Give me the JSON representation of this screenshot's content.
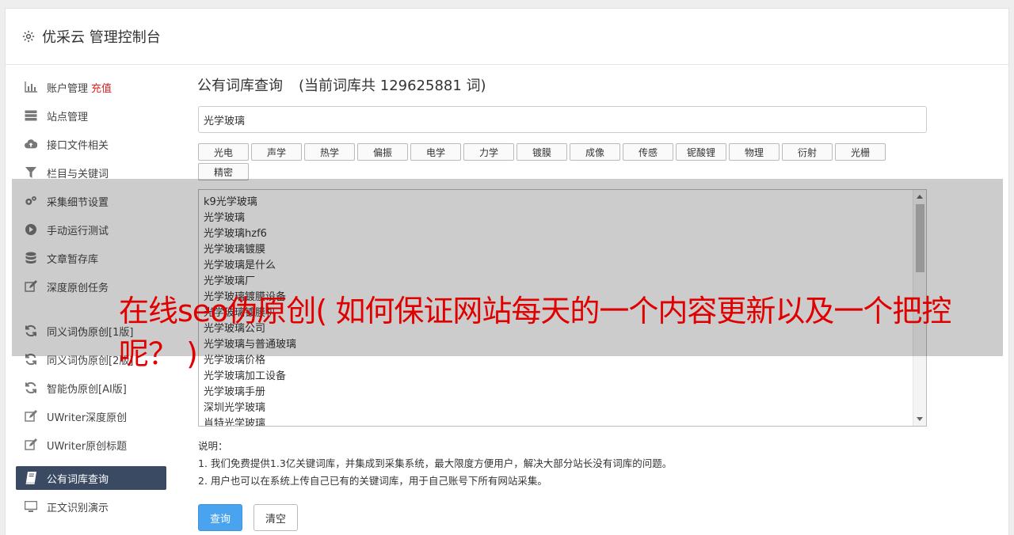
{
  "header": {
    "title": "优采云 管理控制台"
  },
  "sidebar": {
    "items": [
      {
        "label": "账户管理",
        "badge": "充值",
        "icon": "bar-chart-icon"
      },
      {
        "label": "站点管理",
        "icon": "server-icon"
      },
      {
        "label": "接口文件相关",
        "icon": "cloud-upload-icon"
      },
      {
        "label": "栏目与关键词",
        "icon": "filter-icon"
      },
      {
        "label": "采集细节设置",
        "icon": "gears-icon"
      },
      {
        "label": "手动运行测试",
        "icon": "play-circle-icon"
      },
      {
        "label": "文章暂存库",
        "icon": "database-icon"
      },
      {
        "label": "深度原创任务",
        "icon": "edit-icon"
      },
      {
        "label": "同义词伪原创[1版]",
        "icon": "refresh-icon"
      },
      {
        "label": "同义词伪原创[2版]",
        "icon": "refresh-icon"
      },
      {
        "label": "智能伪原创[AI版]",
        "icon": "refresh-icon"
      },
      {
        "label": "UWriter深度原创",
        "icon": "edit-icon"
      },
      {
        "label": "UWriter原创标题",
        "icon": "edit-icon"
      },
      {
        "label": "公有词库查询",
        "icon": "book-icon"
      },
      {
        "label": "正文识别演示",
        "icon": "monitor-icon"
      }
    ]
  },
  "main": {
    "title": "公有词库查询",
    "count_text": "(当前词库共 129625881 词)",
    "search_value": "光学玻璃",
    "tags": [
      "光电",
      "声学",
      "热学",
      "偏振",
      "电学",
      "力学",
      "镀膜",
      "成像",
      "传感",
      "铌酸锂",
      "物理",
      "衍射",
      "光栅",
      "精密"
    ],
    "results": [
      "k9光学玻璃",
      "光学玻璃",
      "光学玻璃hzf6",
      "光学玻璃镀膜",
      "光学玻璃是什么",
      "光学玻璃厂",
      "光学玻璃镀膜设备",
      "光学玻璃镀膜机",
      "光学玻璃公司",
      "光学玻璃与普通玻璃",
      "光学玻璃价格",
      "光学玻璃加工设备",
      "光学玻璃手册",
      "深圳光学玻璃",
      "肖特光学玻璃"
    ],
    "notes": {
      "heading": "说明：",
      "line1": "1. 我们免费提供1.3亿关键词库，并集成到采集系统，最大限度方便用户，解决大部分站长没有词库的问题。",
      "line2": "2. 用户也可以在系统上传自己已有的关键词库，用于自己账号下所有网站采集。"
    },
    "buttons": {
      "query": "查询",
      "clear": "清空"
    }
  },
  "overlay": {
    "headline": "在线seo伪原创( 如何保证网站每天的一个内容更新以及一个把控呢？ )"
  },
  "colors": {
    "active_nav": "#3b4a63",
    "primary": "#4aa3ee",
    "headline": "#e00000",
    "badge": "#e02020"
  }
}
